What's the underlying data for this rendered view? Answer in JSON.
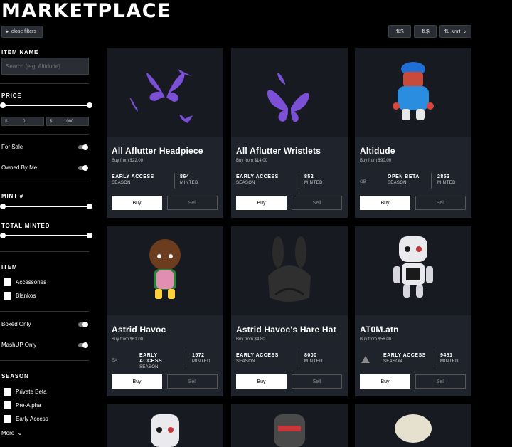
{
  "header": {
    "title": "MARKETPLACE",
    "close_filters": "close filters"
  },
  "sort": {
    "asc_label": "$",
    "desc_label": "$",
    "sort_label": "sort"
  },
  "filters": {
    "item_name": {
      "label": "ITEM NAME",
      "placeholder": "Search (e.g. Altidude)"
    },
    "price": {
      "label": "PRICE",
      "currency": "$",
      "min": "0",
      "max": "1000"
    },
    "for_sale": "For Sale",
    "owned_by_me": "Owned By Me",
    "mint": "MINT #",
    "total_minted": "TOTAL MINTED",
    "item": {
      "label": "ITEM",
      "options": [
        "Accessories",
        "Blankos"
      ]
    },
    "boxed_only": "Boxed Only",
    "mashup_only": "MashUP Only",
    "season": {
      "label": "SEASON",
      "options": [
        "Private Beta",
        "Pre-Alpha",
        "Early Access"
      ]
    },
    "more": "More"
  },
  "cards": [
    {
      "name": "All Aflutter Headpiece",
      "price": "Buy from $22.00",
      "season": "EARLY ACCESS",
      "season_sub": "SEASON",
      "minted": "864",
      "minted_sub": "MINTED",
      "buy": "Buy",
      "sell": "Sell"
    },
    {
      "name": "All Aflutter Wristlets",
      "price": "Buy from $14.00",
      "season": "EARLY ACCESS",
      "season_sub": "SEASON",
      "minted": "852",
      "minted_sub": "MINTED",
      "buy": "Buy",
      "sell": "Sell"
    },
    {
      "name": "Altidude",
      "price": "Buy from $90.00",
      "season": "OPEN BETA",
      "season_sub": "SEASON",
      "minted": "2853",
      "minted_sub": "MINTED",
      "buy": "Buy",
      "sell": "Sell"
    },
    {
      "name": "Astrid Havoc",
      "price": "Buy from $61.00",
      "season": "EARLY ACCESS",
      "season_sub": "SEASON",
      "minted": "1572",
      "minted_sub": "MINTED",
      "buy": "Buy",
      "sell": "Sell"
    },
    {
      "name": "Astrid Havoc's Hare Hat",
      "price": "Buy from $4.80",
      "season": "EARLY ACCESS",
      "season_sub": "SEASON",
      "minted": "8000",
      "minted_sub": "MINTED",
      "buy": "Buy",
      "sell": "Sell"
    },
    {
      "name": "AT0M.atn",
      "price": "Buy from $58.00",
      "season": "EARLY ACCESS",
      "season_sub": "SEASON",
      "minted": "9481",
      "minted_sub": "MINTED",
      "buy": "Buy",
      "sell": "Sell"
    }
  ],
  "colors": {
    "background": "#000000",
    "card": "#1f232b",
    "butterfly": "#7b4fd6"
  }
}
